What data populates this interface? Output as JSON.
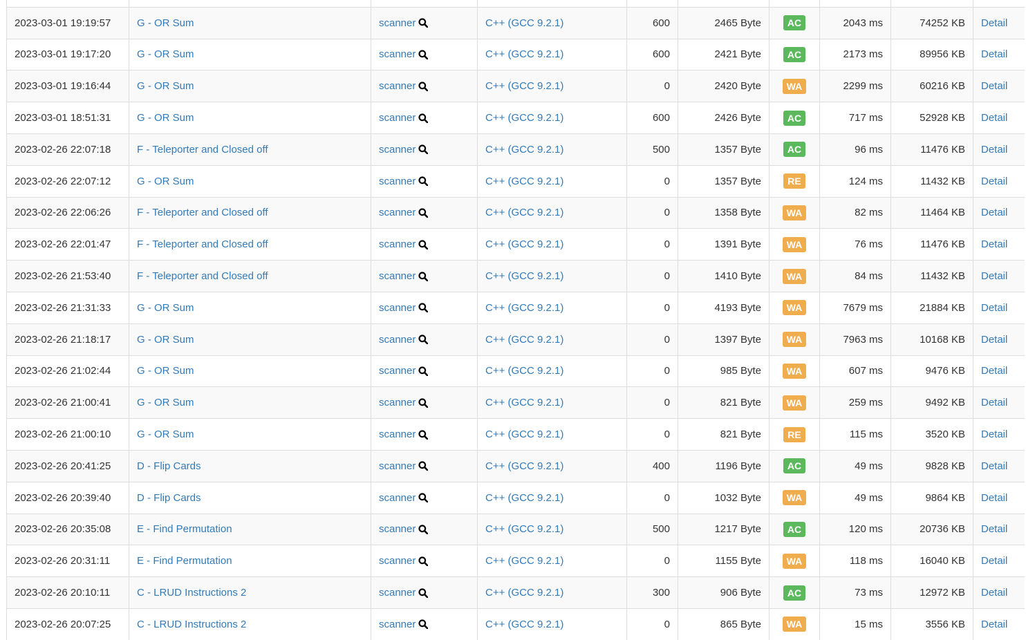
{
  "colors": {
    "AC": "#5cb85c",
    "WA": "#f0ad4e",
    "RE": "#f0ad4e",
    "link": "#337ab7"
  },
  "rows": [
    {
      "time": "",
      "task": "",
      "user": "",
      "lang": "",
      "score": "",
      "size": "",
      "status": "",
      "exec": "",
      "mem": "",
      "detail": ""
    },
    {
      "time": "2023-03-01 19:19:57",
      "task": "G - OR Sum",
      "user": "scanner",
      "lang": "C++ (GCC 9.2.1)",
      "score": "600",
      "size": "2465 Byte",
      "status": "AC",
      "exec": "2043 ms",
      "mem": "74252 KB",
      "detail": "Detail"
    },
    {
      "time": "2023-03-01 19:17:20",
      "task": "G - OR Sum",
      "user": "scanner",
      "lang": "C++ (GCC 9.2.1)",
      "score": "600",
      "size": "2421 Byte",
      "status": "AC",
      "exec": "2173 ms",
      "mem": "89956 KB",
      "detail": "Detail"
    },
    {
      "time": "2023-03-01 19:16:44",
      "task": "G - OR Sum",
      "user": "scanner",
      "lang": "C++ (GCC 9.2.1)",
      "score": "0",
      "size": "2420 Byte",
      "status": "WA",
      "exec": "2299 ms",
      "mem": "60216 KB",
      "detail": "Detail"
    },
    {
      "time": "2023-03-01 18:51:31",
      "task": "G - OR Sum",
      "user": "scanner",
      "lang": "C++ (GCC 9.2.1)",
      "score": "600",
      "size": "2426 Byte",
      "status": "AC",
      "exec": "717 ms",
      "mem": "52928 KB",
      "detail": "Detail"
    },
    {
      "time": "2023-02-26 22:07:18",
      "task": "F - Teleporter and Closed off",
      "user": "scanner",
      "lang": "C++ (GCC 9.2.1)",
      "score": "500",
      "size": "1357 Byte",
      "status": "AC",
      "exec": "96 ms",
      "mem": "11476 KB",
      "detail": "Detail"
    },
    {
      "time": "2023-02-26 22:07:12",
      "task": "G - OR Sum",
      "user": "scanner",
      "lang": "C++ (GCC 9.2.1)",
      "score": "0",
      "size": "1357 Byte",
      "status": "RE",
      "exec": "124 ms",
      "mem": "11432 KB",
      "detail": "Detail"
    },
    {
      "time": "2023-02-26 22:06:26",
      "task": "F - Teleporter and Closed off",
      "user": "scanner",
      "lang": "C++ (GCC 9.2.1)",
      "score": "0",
      "size": "1358 Byte",
      "status": "WA",
      "exec": "82 ms",
      "mem": "11464 KB",
      "detail": "Detail"
    },
    {
      "time": "2023-02-26 22:01:47",
      "task": "F - Teleporter and Closed off",
      "user": "scanner",
      "lang": "C++ (GCC 9.2.1)",
      "score": "0",
      "size": "1391 Byte",
      "status": "WA",
      "exec": "76 ms",
      "mem": "11476 KB",
      "detail": "Detail"
    },
    {
      "time": "2023-02-26 21:53:40",
      "task": "F - Teleporter and Closed off",
      "user": "scanner",
      "lang": "C++ (GCC 9.2.1)",
      "score": "0",
      "size": "1410 Byte",
      "status": "WA",
      "exec": "84 ms",
      "mem": "11432 KB",
      "detail": "Detail"
    },
    {
      "time": "2023-02-26 21:31:33",
      "task": "G - OR Sum",
      "user": "scanner",
      "lang": "C++ (GCC 9.2.1)",
      "score": "0",
      "size": "4193 Byte",
      "status": "WA",
      "exec": "7679 ms",
      "mem": "21884 KB",
      "detail": "Detail"
    },
    {
      "time": "2023-02-26 21:18:17",
      "task": "G - OR Sum",
      "user": "scanner",
      "lang": "C++ (GCC 9.2.1)",
      "score": "0",
      "size": "1397 Byte",
      "status": "WA",
      "exec": "7963 ms",
      "mem": "10168 KB",
      "detail": "Detail"
    },
    {
      "time": "2023-02-26 21:02:44",
      "task": "G - OR Sum",
      "user": "scanner",
      "lang": "C++ (GCC 9.2.1)",
      "score": "0",
      "size": "985 Byte",
      "status": "WA",
      "exec": "607 ms",
      "mem": "9476 KB",
      "detail": "Detail"
    },
    {
      "time": "2023-02-26 21:00:41",
      "task": "G - OR Sum",
      "user": "scanner",
      "lang": "C++ (GCC 9.2.1)",
      "score": "0",
      "size": "821 Byte",
      "status": "WA",
      "exec": "259 ms",
      "mem": "9492 KB",
      "detail": "Detail"
    },
    {
      "time": "2023-02-26 21:00:10",
      "task": "G - OR Sum",
      "user": "scanner",
      "lang": "C++ (GCC 9.2.1)",
      "score": "0",
      "size": "821 Byte",
      "status": "RE",
      "exec": "115 ms",
      "mem": "3520 KB",
      "detail": "Detail"
    },
    {
      "time": "2023-02-26 20:41:25",
      "task": "D - Flip Cards",
      "user": "scanner",
      "lang": "C++ (GCC 9.2.1)",
      "score": "400",
      "size": "1196 Byte",
      "status": "AC",
      "exec": "49 ms",
      "mem": "9828 KB",
      "detail": "Detail"
    },
    {
      "time": "2023-02-26 20:39:40",
      "task": "D - Flip Cards",
      "user": "scanner",
      "lang": "C++ (GCC 9.2.1)",
      "score": "0",
      "size": "1032 Byte",
      "status": "WA",
      "exec": "49 ms",
      "mem": "9864 KB",
      "detail": "Detail"
    },
    {
      "time": "2023-02-26 20:35:08",
      "task": "E - Find Permutation",
      "user": "scanner",
      "lang": "C++ (GCC 9.2.1)",
      "score": "500",
      "size": "1217 Byte",
      "status": "AC",
      "exec": "120 ms",
      "mem": "20736 KB",
      "detail": "Detail"
    },
    {
      "time": "2023-02-26 20:31:11",
      "task": "E - Find Permutation",
      "user": "scanner",
      "lang": "C++ (GCC 9.2.1)",
      "score": "0",
      "size": "1155 Byte",
      "status": "WA",
      "exec": "118 ms",
      "mem": "16040 KB",
      "detail": "Detail"
    },
    {
      "time": "2023-02-26 20:10:11",
      "task": "C - LRUD Instructions 2",
      "user": "scanner",
      "lang": "C++ (GCC 9.2.1)",
      "score": "300",
      "size": "906 Byte",
      "status": "AC",
      "exec": "73 ms",
      "mem": "12972 KB",
      "detail": "Detail"
    },
    {
      "time": "2023-02-26 20:07:25",
      "task": "C - LRUD Instructions 2",
      "user": "scanner",
      "lang": "C++ (GCC 9.2.1)",
      "score": "0",
      "size": "865 Byte",
      "status": "WA",
      "exec": "15 ms",
      "mem": "3556 KB",
      "detail": "Detail"
    }
  ]
}
